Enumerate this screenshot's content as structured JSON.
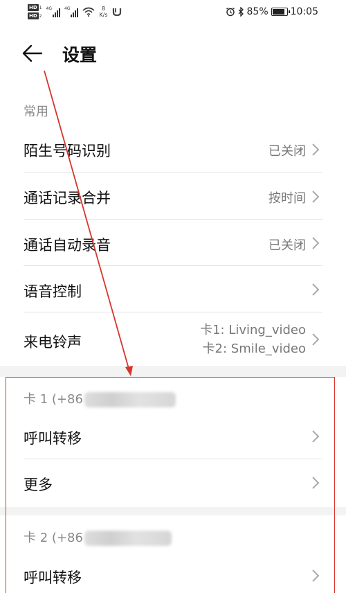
{
  "status_bar": {
    "hd1": "HD",
    "hd1_sub": "1",
    "hd2": "HD",
    "hd2_sub": "2",
    "net1": "4G",
    "net2": "4G",
    "speed_value": "8",
    "speed_unit": "K/s",
    "battery_text": "85%",
    "battery_level": 0.85,
    "time": "10:05"
  },
  "header": {
    "title": "设置"
  },
  "general": {
    "section_label": "常用",
    "items": [
      {
        "label": "陌生号码识别",
        "value": "已关闭"
      },
      {
        "label": "通话记录合并",
        "value": "按时间"
      },
      {
        "label": "通话自动录音",
        "value": "已关闭"
      },
      {
        "label": "语音控制",
        "value": ""
      },
      {
        "label": "来电铃声",
        "value_line1": "卡1: Living_video",
        "value_line2": "卡2: Smile_video"
      }
    ]
  },
  "sim1": {
    "section_label": "卡 1 (+86",
    "items": [
      {
        "label": "呼叫转移"
      },
      {
        "label": "更多"
      }
    ]
  },
  "sim2": {
    "section_label": "卡 2 (+86",
    "items": [
      {
        "label": "呼叫转移"
      }
    ]
  },
  "colors": {
    "annotation": "#d8342c",
    "divider": "#e4e4e4",
    "secondary_text": "#777777"
  }
}
